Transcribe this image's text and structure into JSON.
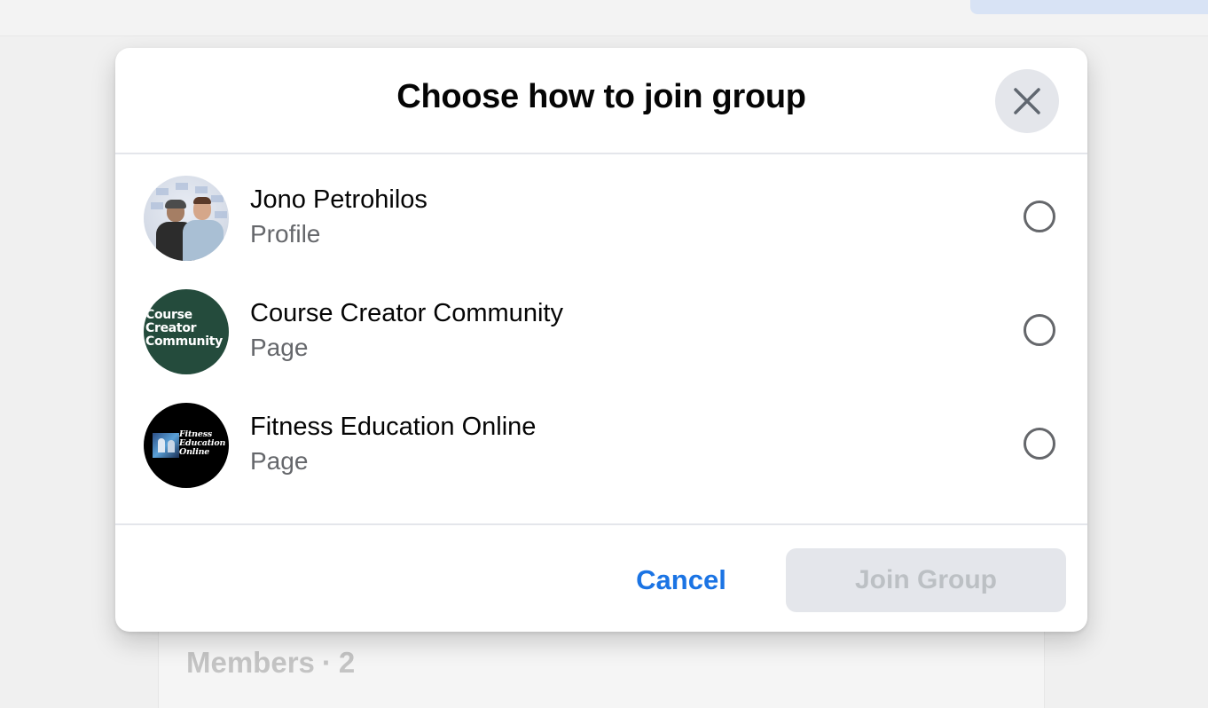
{
  "background": {
    "members_label": "Members",
    "members_separator": "·",
    "members_count": "2"
  },
  "dialog": {
    "title": "Choose how to join group",
    "close_icon": "close-icon",
    "options": [
      {
        "name": "Jono Petrohilos",
        "type": "Profile",
        "avatar": "profile-photo",
        "selected": false
      },
      {
        "name": "Course Creator Community",
        "type": "Page",
        "avatar": "page-logo",
        "avatar_text": [
          "Course",
          "Creator",
          "Community"
        ],
        "selected": false
      },
      {
        "name": "Fitness Education Online",
        "type": "Page",
        "avatar": "page-logo",
        "avatar_text": [
          "Fitness",
          "Education",
          "Online"
        ],
        "selected": false
      }
    ],
    "footer": {
      "cancel_label": "Cancel",
      "join_label": "Join Group",
      "join_disabled": true
    }
  },
  "colors": {
    "accent": "#1b74e4",
    "secondary_text": "#65676b",
    "disabled_button_bg": "#e4e6eb",
    "disabled_button_text": "#bcc0c4",
    "ccc_avatar_bg": "#244b3c"
  }
}
